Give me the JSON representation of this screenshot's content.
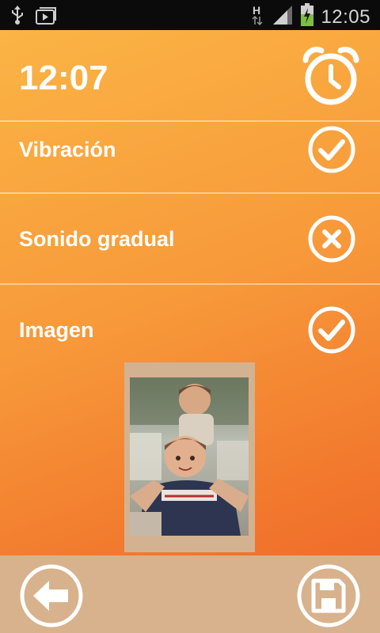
{
  "status_bar": {
    "time": "12:05",
    "network_type": "H",
    "icons": [
      "usb-icon",
      "media-icon",
      "network-h-icon",
      "signal-icon",
      "battery-charging-icon"
    ]
  },
  "header": {
    "time": "12:07",
    "icon": "alarm-clock-icon"
  },
  "settings": [
    {
      "label": "Vibración",
      "enabled": true,
      "icon": "check-circle-icon"
    },
    {
      "label": "Sonido gradual",
      "enabled": false,
      "icon": "x-circle-icon"
    },
    {
      "label": "Imagen",
      "enabled": true,
      "icon": "check-circle-icon"
    }
  ],
  "image_preview": {
    "icon": "photo-thumbnail"
  },
  "bottom_bar": {
    "back_icon": "back-arrow-icon",
    "save_icon": "save-disk-icon"
  },
  "colors": {
    "gradient_top": "#fbb445",
    "gradient_bottom": "#ef6428",
    "bottom_bar": "#d8b28c",
    "foreground": "#ffffff"
  }
}
